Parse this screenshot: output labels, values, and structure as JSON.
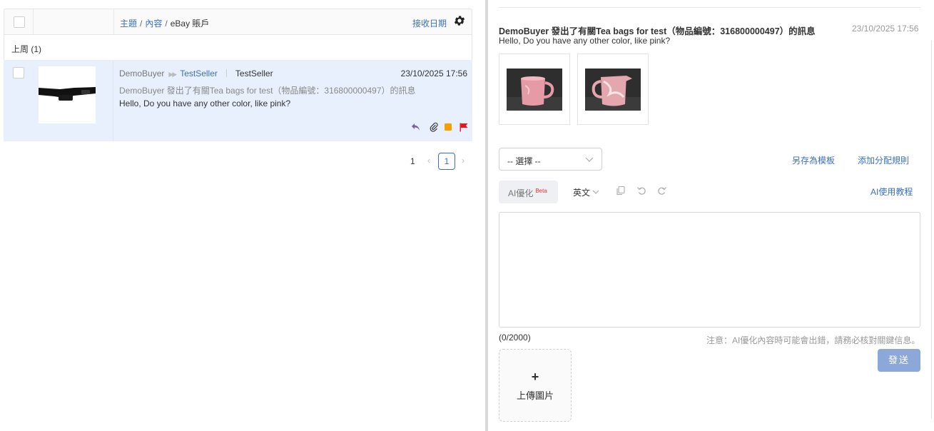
{
  "list": {
    "header": {
      "crumb_subject": "主題",
      "crumb_sep1": "/",
      "crumb_content": "內容",
      "crumb_sep2": "/",
      "crumb_account": "eBay 賬戶",
      "received_date": "接收日期",
      "settings_icon": "gear-icon"
    },
    "group_label": "上周 (1)",
    "rows": [
      {
        "buyer": "DemoBuyer",
        "seller_link": "TestSeller",
        "seller": "TestSeller",
        "date": "23/10/2025 17:56",
        "subject": "DemoBuyer 發出了有關Tea bags for test（物品編號：316800000497）的訊息",
        "preview": "Hello, Do you have any other color, like pink?",
        "icons": [
          "reply-icon",
          "attachment-icon",
          "orange-tag-icon",
          "red-flag-icon"
        ]
      }
    ]
  },
  "pagination": {
    "total": "1",
    "current": "1",
    "prev": "‹",
    "next": "›"
  },
  "detail": {
    "title": "DemoBuyer 發出了有關Tea bags for test（物品編號：316800000497）的訊息",
    "date": "23/10/2025 17:56",
    "body": "Hello, Do you have any other color, like pink?"
  },
  "reply": {
    "select_value": "-- 選擇 --",
    "save_template": "另存為模板",
    "add_rule": "添加分配規則",
    "ai_optimize": "AI優化",
    "ai_beta": "Beta",
    "language": "英文",
    "ai_guide": "AI使用教程",
    "counter": "(0/2000)",
    "notice": "注意：AI優化內容時可能會出錯，請務必核對關鍵信息。",
    "send": "發送",
    "upload_plus": "+",
    "upload_label": "上傳圖片"
  },
  "colors": {
    "accent": "#3a6fc4",
    "selected_row": "#e8f0fe",
    "send_button": "#8ca8d8",
    "tag_orange": "#f5a000",
    "flag_red": "#e8161a",
    "reply_purple": "#7b5ea7"
  }
}
